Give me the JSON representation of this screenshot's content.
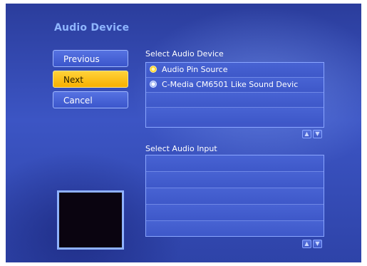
{
  "page_title": "Audio Device",
  "nav": {
    "previous": "Previous",
    "next": "Next",
    "cancel": "Cancel"
  },
  "device_list": {
    "label": "Select Audio Device",
    "items": [
      {
        "text": "Audio Pin Source",
        "selected": true
      },
      {
        "text": "C-Media CM6501 Like Sound Devic",
        "selected": false
      },
      {
        "text": "",
        "selected": false
      },
      {
        "text": "",
        "selected": false
      }
    ]
  },
  "input_list": {
    "label": "Select Audio Input",
    "items": [
      "",
      "",
      "",
      "",
      ""
    ]
  },
  "scroll_icons": {
    "up": "chevron-up-icon",
    "down": "chevron-down-icon"
  },
  "colors": {
    "accent": "#f7b000",
    "title": "#8fb6ff",
    "background": "#3c55c4"
  }
}
